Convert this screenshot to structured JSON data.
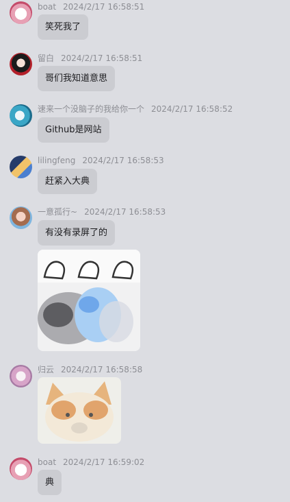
{
  "messages": [
    {
      "name": "boat",
      "time": "2024/2/17 16:58:51",
      "text": "笑死我了",
      "avatar": "boat-avatar"
    },
    {
      "name": "留白",
      "time": "2024/2/17 16:58:51",
      "text": "哥们我知道意思",
      "avatar": "liubai-avatar"
    },
    {
      "name": "速来一个没脑子的我给你一个",
      "time": "2024/2/17 16:58:52",
      "text": "Github是网站",
      "avatar": "anime-avatar"
    },
    {
      "name": "lilingfeng",
      "time": "2024/2/17 16:58:53",
      "text": "赶紧入大典",
      "avatar": "lilingfeng-avatar"
    },
    {
      "name": "一意孤行~",
      "time": "2024/2/17 16:58:53",
      "text": "有没有录屏了的",
      "avatar": "yiyi-avatar"
    },
    {
      "name": "归云",
      "time": "2024/2/17 16:58:58",
      "text": "",
      "avatar": "guiyun-avatar"
    },
    {
      "name": "boat",
      "time": "2024/2/17 16:59:02",
      "text": "典",
      "avatar": "boat-avatar"
    }
  ],
  "colors": {
    "background": "#dcdde2",
    "bubble": "#cbccd1",
    "meta_text": "#8d8e94",
    "message_text": "#1d1d20"
  }
}
